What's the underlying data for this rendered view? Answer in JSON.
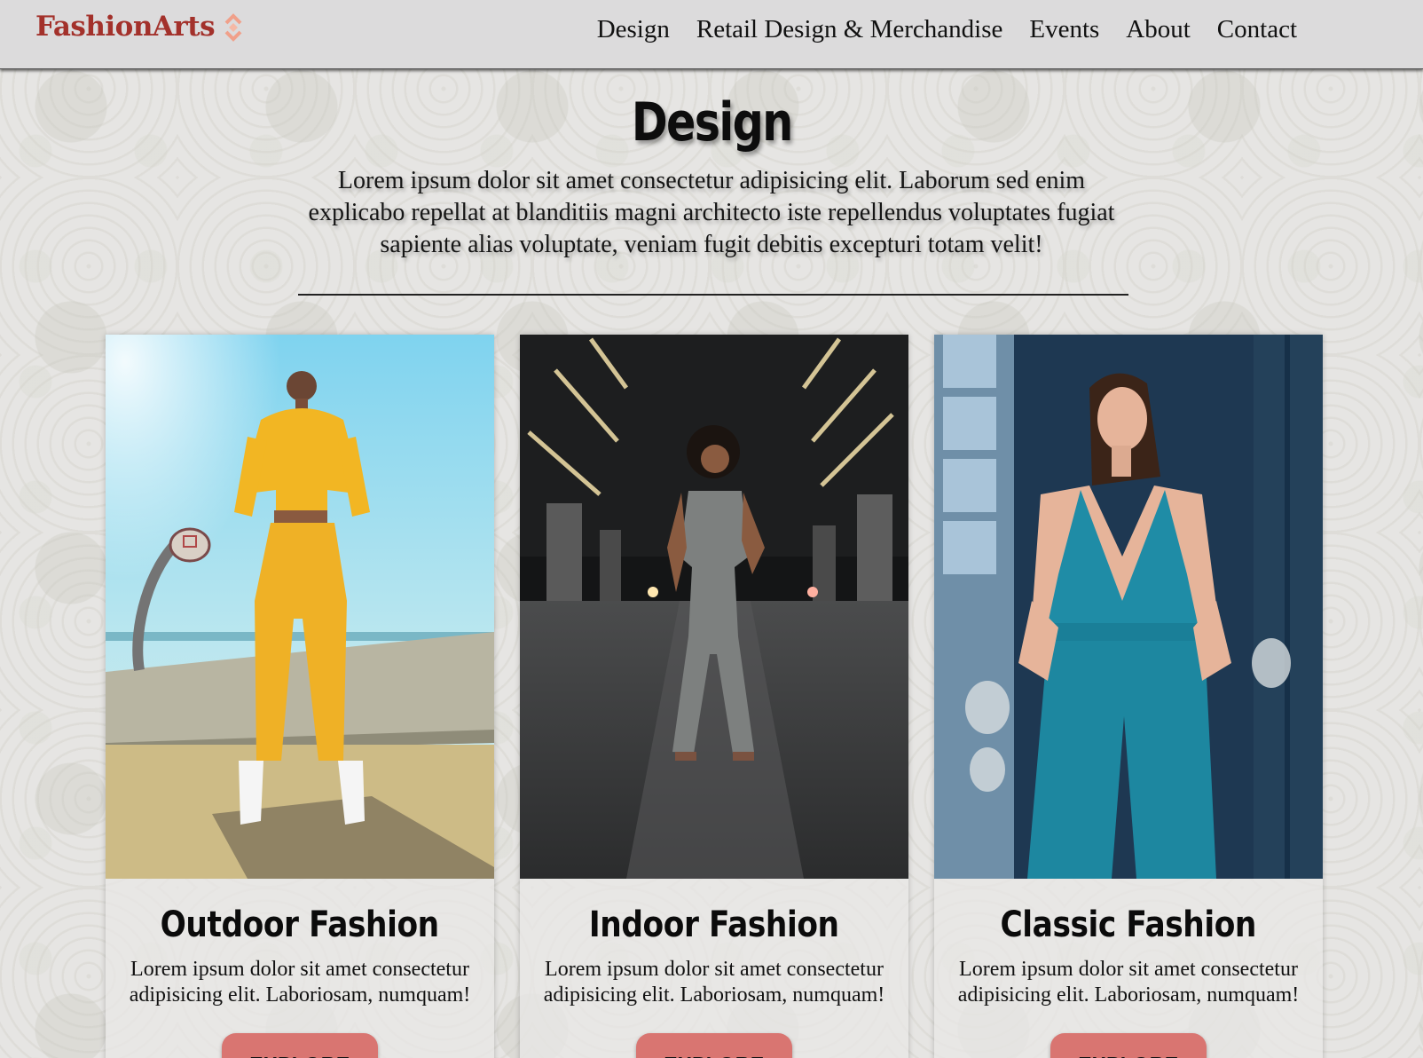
{
  "brand": {
    "name": "FashionArts",
    "icon": "diamond-chevrons-icon",
    "color": "#a3312b",
    "icon_color": "#f0a08a"
  },
  "nav": [
    {
      "label": "Design"
    },
    {
      "label": "Retail Design & Merchandise"
    },
    {
      "label": "Events"
    },
    {
      "label": "About"
    },
    {
      "label": "Contact"
    }
  ],
  "intro": {
    "title": "Design",
    "text": "Lorem ipsum dolor sit amet consectetur adipisicing elit. Laborum sed enim explicabo repellat at blanditiis magni architecto iste repellendus voluptates fugiat sapiente alias voluptate, veniam fugit debitis excepturi totam velit!"
  },
  "cards": [
    {
      "image": "outdoor-fashion-photo",
      "title": "Outdoor Fashion",
      "text": "Lorem ipsum dolor sit amet consectetur adipisicing elit. Laboriosam, numquam!",
      "button": "EXPLORE"
    },
    {
      "image": "indoor-fashion-photo",
      "title": "Indoor Fashion",
      "text": "Lorem ipsum dolor sit amet consectetur adipisicing elit. Laboriosam, numquam!",
      "button": "EXPLORE"
    },
    {
      "image": "classic-fashion-photo",
      "title": "Classic Fashion",
      "text": "Lorem ipsum dolor sit amet consectetur adipisicing elit. Laboriosam, numquam!",
      "button": "EXPLORE"
    }
  ],
  "colors": {
    "accent_button": "#d97571",
    "header_bg": "#dcdbdc",
    "page_bg": "#e6e5e3"
  }
}
